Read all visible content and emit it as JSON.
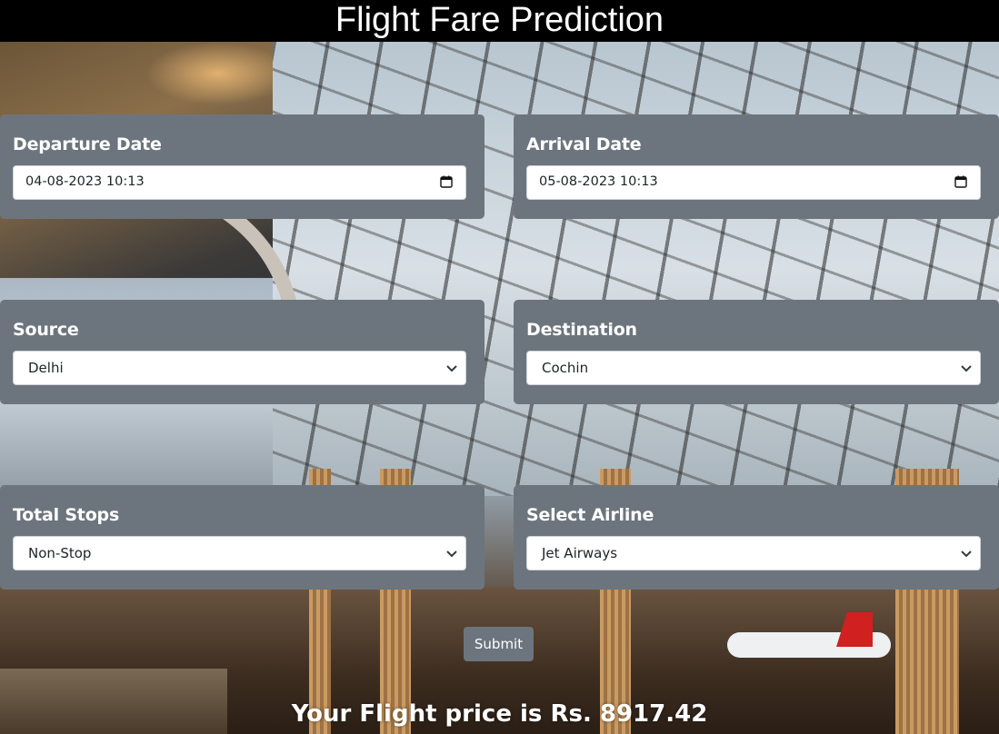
{
  "header": {
    "title": "Flight Fare Prediction"
  },
  "form": {
    "departure": {
      "label": "Departure Date",
      "value": "04-08-2023  10:13",
      "icon": "calendar-icon"
    },
    "arrival": {
      "label": "Arrival Date",
      "value": "05-08-2023  10:13",
      "icon": "calendar-icon"
    },
    "source": {
      "label": "Source",
      "value": "Delhi",
      "icon": "chevron-down-icon"
    },
    "destination": {
      "label": "Destination",
      "value": "Cochin",
      "icon": "chevron-down-icon"
    },
    "stops": {
      "label": "Total Stops",
      "value": "Non-Stop",
      "icon": "chevron-down-icon"
    },
    "airline": {
      "label": "Select Airline",
      "value": "Jet Airways",
      "icon": "chevron-down-icon"
    },
    "submit_label": "Submit"
  },
  "result": {
    "text": "Your Flight price is Rs. 8917.42"
  },
  "colors": {
    "header_bg": "#000000",
    "card_bg": "#6c757d",
    "button_bg": "#6c757d",
    "text_light": "#ffffff"
  }
}
